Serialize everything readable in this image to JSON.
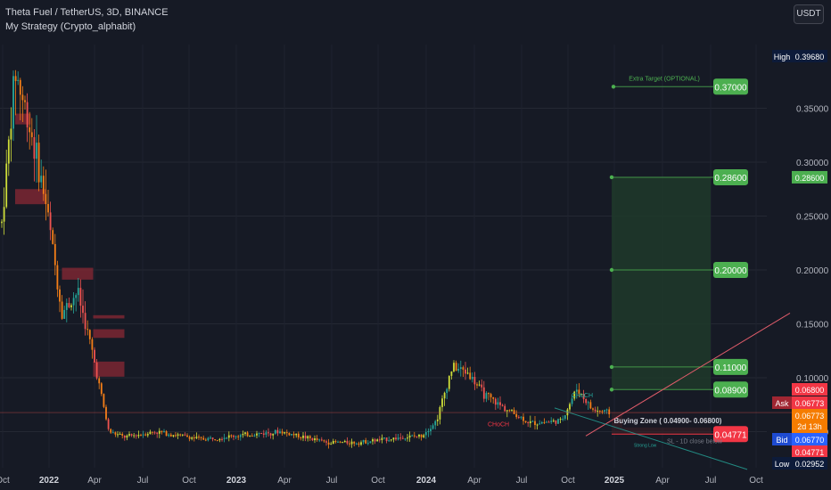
{
  "header": {
    "symbol": "Theta Fuel / TetherUS, 3D, BINANCE",
    "strategy": "My Strategy (Crypto_alphabit)",
    "currency_button": "USDT"
  },
  "colors": {
    "background": "#161a25",
    "up": "#26a69a",
    "down": "#ef5350",
    "candle_orange": "#f57f17",
    "candle_yellow": "#cddc39",
    "target_green": "#4caf50",
    "stop_red": "#f23645",
    "zone_red": "#7b2733",
    "bid_blue": "#2962ff",
    "high_low_navy": "#0d1b3a"
  },
  "chart_data": {
    "type": "candlestick",
    "pair": "TFUEL/USDT",
    "timeframe": "3D",
    "y_scale": "linear",
    "ylim": [
      0.0,
      0.4
    ],
    "x_ticks": [
      "Oct",
      "2022",
      "Apr",
      "Jul",
      "Oct",
      "2023",
      "Apr",
      "Jul",
      "Oct",
      "2024",
      "Apr",
      "Jul",
      "Oct",
      "2025",
      "Apr",
      "Jul",
      "Oct"
    ],
    "y_ticks": [
      "0.35000",
      "0.30000",
      "0.25000",
      "0.20000",
      "0.15000",
      "0.10000",
      "0.05000"
    ],
    "price_path": {
      "x": [
        "2021-10",
        "2021-11",
        "2021-12",
        "2022-01",
        "2022-02",
        "2022-03",
        "2022-04",
        "2022-05",
        "2022-06",
        "2022-08",
        "2022-11",
        "2023-01",
        "2023-04",
        "2023-07",
        "2023-09",
        "2023-12",
        "2024-01",
        "2024-02",
        "2024-03",
        "2024-04",
        "2024-05",
        "2024-06",
        "2024-08",
        "2024-10",
        "2024-11",
        "2024-12",
        "2025-01"
      ],
      "y": [
        0.22,
        0.385,
        0.33,
        0.26,
        0.16,
        0.18,
        0.12,
        0.05,
        0.045,
        0.05,
        0.043,
        0.046,
        0.05,
        0.04,
        0.04,
        0.045,
        0.046,
        0.06,
        0.11,
        0.105,
        0.085,
        0.075,
        0.058,
        0.06,
        0.09,
        0.07,
        0.0677
      ]
    },
    "targets": [
      {
        "label": "0.37000",
        "value": 0.37,
        "annotation": "Extra Target (OPTIONAL)"
      },
      {
        "label": "0.28600",
        "value": 0.286
      },
      {
        "label": "0.20000",
        "value": 0.2
      },
      {
        "label": "0.11000",
        "value": 0.11
      },
      {
        "label": "0.08900",
        "value": 0.089
      }
    ],
    "stop_loss": {
      "label": "0.04771",
      "value": 0.04771,
      "annotation": "SL - 1D close below"
    },
    "buying_zone": {
      "label": "Buying Zone ( 0.04900- 0.06800)",
      "low": 0.049,
      "high": 0.068
    },
    "annotations": [
      "CHoCH",
      "CHoCH",
      "Strong Low"
    ],
    "supply_zones": [
      {
        "x": [
          "2021-11",
          "2021-12"
        ],
        "y": [
          0.345,
          0.335
        ]
      },
      {
        "x": [
          "2021-11",
          "2022-01"
        ],
        "y": [
          0.275,
          0.261
        ]
      },
      {
        "x": [
          "2022-02",
          "2022-04"
        ],
        "y": [
          0.202,
          0.191
        ]
      },
      {
        "x": [
          "2022-04",
          "2022-06"
        ],
        "y": [
          0.158,
          0.155
        ]
      },
      {
        "x": [
          "2022-04",
          "2022-06"
        ],
        "y": [
          0.145,
          0.137
        ]
      },
      {
        "x": [
          "2022-04",
          "2022-06"
        ],
        "y": [
          0.115,
          0.101
        ]
      }
    ],
    "price_labels": {
      "high": {
        "label": "High",
        "value": "0.39680"
      },
      "ask_top": {
        "value": "0.06800"
      },
      "ask": {
        "label": "Ask",
        "value": "0.06773"
      },
      "last": {
        "value": "0.06773",
        "countdown": "2d 13h"
      },
      "bid": {
        "label": "Bid",
        "value": "0.06770"
      },
      "stop": {
        "value": "0.04771"
      },
      "low": {
        "label": "Low",
        "value": "0.02952"
      },
      "target_top": {
        "value": "0.28600"
      }
    }
  }
}
